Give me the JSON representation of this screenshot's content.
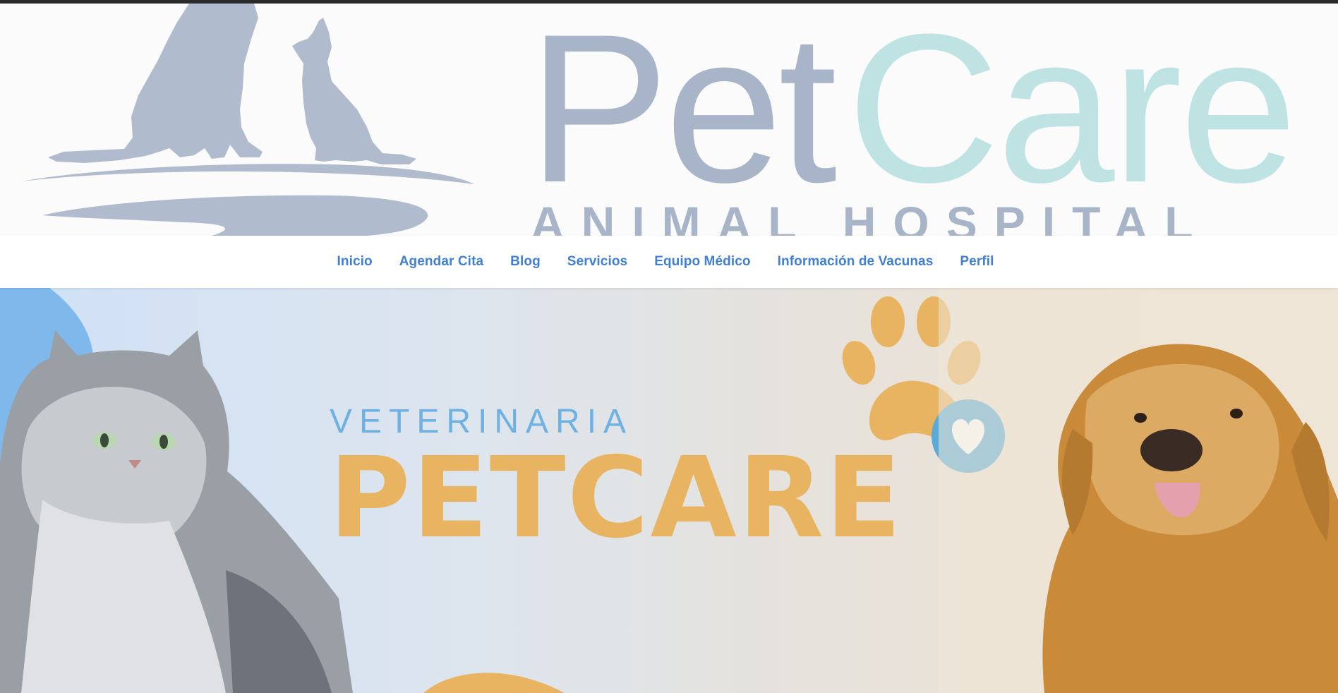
{
  "header": {
    "logo": {
      "word_pet": "Pet",
      "word_care": "Care",
      "subtitle": "ANIMAL HOSPITAL",
      "colors": {
        "pet": "#a8b5c8",
        "care": "#bfe3e3"
      }
    }
  },
  "nav": {
    "items": [
      {
        "label": "Inicio"
      },
      {
        "label": "Agendar Cita"
      },
      {
        "label": "Blog"
      },
      {
        "label": "Servicios"
      },
      {
        "label": "Equipo Médico"
      },
      {
        "label": "Información de Vacunas"
      },
      {
        "label": "Perfil"
      }
    ],
    "link_color": "#3f7fd6"
  },
  "hero": {
    "eyebrow": "VETERINARIA",
    "title": "PETCARE",
    "colors": {
      "eyebrow": "#6fb1e2",
      "title": "#e8b462",
      "heart_badge": "#5aaad8"
    },
    "icons": [
      "paw-icon",
      "heart-icon"
    ]
  }
}
